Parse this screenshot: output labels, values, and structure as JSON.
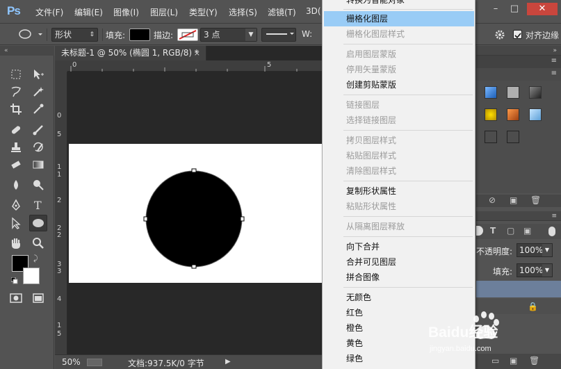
{
  "app": {
    "logo": "Ps",
    "menus": [
      "文件(F)",
      "编辑(E)",
      "图像(I)",
      "图层(L)",
      "类型(Y)",
      "选择(S)",
      "滤镜(T)",
      "3D("
    ]
  },
  "window_controls": {
    "minimize": "–",
    "restore": "□",
    "close": "✕"
  },
  "options": {
    "tool_mode": "形状",
    "fill_label": "填充:",
    "stroke_label": "描边:",
    "stroke_size": "3 点",
    "width_label": "W:",
    "align_edges_label": "对齐边缘"
  },
  "document": {
    "tab_title": "未标题-1 @ 50% (椭圆 1, RGB/8) *",
    "close": "×",
    "ruler_top": [
      "0",
      "5"
    ],
    "ruler_left": [
      "0",
      "5",
      "1",
      "1",
      "2",
      "2",
      "2",
      "3",
      "3",
      "4",
      "1",
      "5"
    ],
    "zoom": "50%",
    "doc_info": "文档:937.5K/0 字节"
  },
  "context_menu": {
    "items": [
      {
        "label": "转换为智能对象",
        "enabled": true,
        "highlighted": false
      },
      {
        "label": "栅格化图层",
        "enabled": true,
        "highlighted": true
      },
      {
        "label": "栅格化图层样式",
        "enabled": false,
        "highlighted": false
      },
      {
        "label": "启用图层蒙版",
        "enabled": false,
        "highlighted": false
      },
      {
        "label": "停用矢量蒙版",
        "enabled": false,
        "highlighted": false
      },
      {
        "label": "创建剪贴蒙版",
        "enabled": true,
        "highlighted": false
      },
      {
        "label": "链接图层",
        "enabled": false,
        "highlighted": false
      },
      {
        "label": "选择链接图层",
        "enabled": false,
        "highlighted": false
      },
      {
        "label": "拷贝图层样式",
        "enabled": false,
        "highlighted": false
      },
      {
        "label": "粘贴图层样式",
        "enabled": false,
        "highlighted": false
      },
      {
        "label": "清除图层样式",
        "enabled": false,
        "highlighted": false
      },
      {
        "label": "复制形状属性",
        "enabled": true,
        "highlighted": false
      },
      {
        "label": "粘贴形状属性",
        "enabled": false,
        "highlighted": false
      },
      {
        "label": "从隔离图层释放",
        "enabled": false,
        "highlighted": false
      },
      {
        "label": "向下合并",
        "enabled": true,
        "highlighted": false
      },
      {
        "label": "合并可见图层",
        "enabled": true,
        "highlighted": false
      },
      {
        "label": "拼合图像",
        "enabled": true,
        "highlighted": false
      },
      {
        "label": "无颜色",
        "enabled": true,
        "highlighted": false
      },
      {
        "label": "红色",
        "enabled": true,
        "highlighted": false
      },
      {
        "label": "橙色",
        "enabled": true,
        "highlighted": false
      },
      {
        "label": "黄色",
        "enabled": true,
        "highlighted": false
      },
      {
        "label": "绿色",
        "enabled": true,
        "highlighted": false
      }
    ]
  },
  "layers_panel": {
    "opacity_label": "不透明度:",
    "opacity_value": "100%",
    "fill_label": "填充:",
    "fill_value": "100%"
  },
  "watermark": {
    "brand": "Baidu经验",
    "url": "jingyan.baidu.com"
  },
  "colors": {
    "ui_bg": "#535353",
    "canvas_bg": "#282828",
    "menu_bg": "#f1f1f1",
    "menu_highlight": "#99ccf6",
    "logo_blue": "#8fc6ff"
  }
}
